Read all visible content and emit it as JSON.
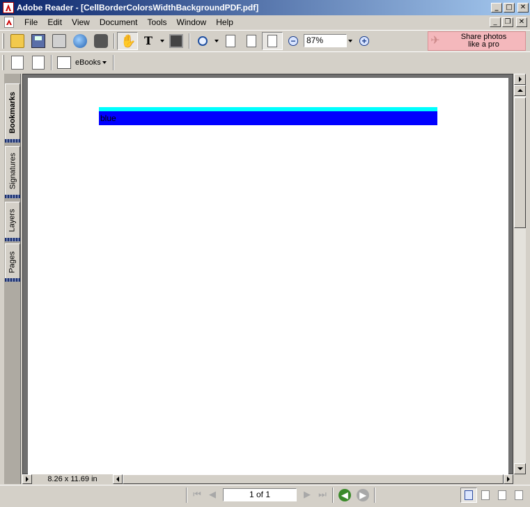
{
  "window": {
    "title": "Adobe Reader - [CellBorderColorsWidthBackgroundPDF.pdf]",
    "minimize_glyph": "_",
    "maximize_glyph": "□",
    "close_glyph": "✕",
    "restore_glyph": "❐"
  },
  "menu": {
    "items": [
      "File",
      "Edit",
      "View",
      "Document",
      "Tools",
      "Window",
      "Help"
    ]
  },
  "toolbar": {
    "zoom_value": "87%",
    "share_label_line1": "Share photos",
    "share_label_line2": "like a pro",
    "ebooks_label": "eBooks",
    "hand_glyph": "✋",
    "text_glyph": "T",
    "zoom_out_glyph": "−",
    "zoom_in_glyph": "+",
    "plane_glyph": "✈"
  },
  "nav_tabs": [
    "Bookmarks",
    "Signatures",
    "Layers",
    "Pages"
  ],
  "document": {
    "cell_text": "blue",
    "cell_background_color": "#0000ff",
    "cell_border_color": "#00ffff",
    "page_size": "8.26 x 11.69 in"
  },
  "statusbar": {
    "page_indicator": "1 of 1",
    "first_glyph": "⏮",
    "prev_glyph": "◀",
    "next_glyph": "▶",
    "last_glyph": "⏭",
    "back_glyph": "◀",
    "forward_glyph": "▶"
  }
}
